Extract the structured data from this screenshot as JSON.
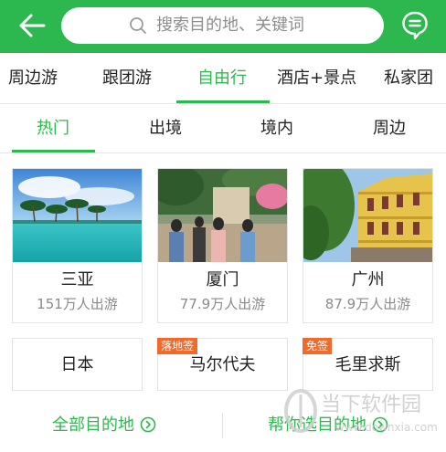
{
  "header": {
    "search_placeholder": "搜索目的地、关键词",
    "accent_color": "#2db84f"
  },
  "category_tabs": [
    {
      "label": "周边游",
      "active": false
    },
    {
      "label": "跟团游",
      "active": false
    },
    {
      "label": "自由行",
      "active": true
    },
    {
      "label": "酒店+景点",
      "active": false
    },
    {
      "label": "私家团",
      "active": false
    }
  ],
  "region_tabs": [
    {
      "label": "热门",
      "active": true
    },
    {
      "label": "出境",
      "active": false
    },
    {
      "label": "境内",
      "active": false
    },
    {
      "label": "周边",
      "active": false
    }
  ],
  "destinations": [
    {
      "name": "三亚",
      "travelers": "151万人出游"
    },
    {
      "name": "厦门",
      "travelers": "77.9万人出游"
    },
    {
      "name": "广州",
      "travelers": "87.9万人出游"
    }
  ],
  "more_destinations": [
    {
      "name": "日本",
      "tag": ""
    },
    {
      "name": "马尔代夫",
      "tag": "落地签"
    },
    {
      "name": "毛里求斯",
      "tag": "免签"
    }
  ],
  "footer": {
    "all_destinations": "全部目的地",
    "help_choose": "帮你选目的地"
  },
  "watermark": {
    "text": "当下软件园",
    "url": "www.downxia.com"
  }
}
